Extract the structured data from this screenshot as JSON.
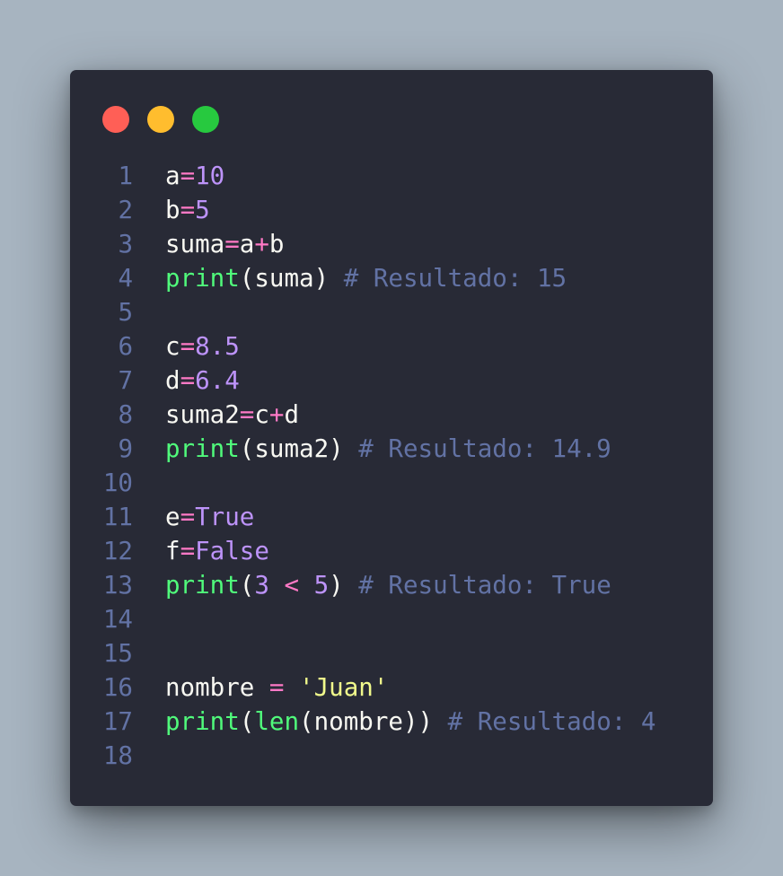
{
  "window": {
    "controls": {
      "close_color": "#ff5f56",
      "minimize_color": "#ffbd2e",
      "maximize_color": "#27c93f"
    }
  },
  "code": {
    "lines": [
      {
        "number": "1",
        "tokens": [
          {
            "t": "id",
            "v": "a"
          },
          {
            "t": "op",
            "v": "="
          },
          {
            "t": "num",
            "v": "10"
          }
        ]
      },
      {
        "number": "2",
        "tokens": [
          {
            "t": "id",
            "v": "b"
          },
          {
            "t": "op",
            "v": "="
          },
          {
            "t": "num",
            "v": "5"
          }
        ]
      },
      {
        "number": "3",
        "tokens": [
          {
            "t": "id",
            "v": "suma"
          },
          {
            "t": "op",
            "v": "="
          },
          {
            "t": "id",
            "v": "a"
          },
          {
            "t": "op",
            "v": "+"
          },
          {
            "t": "id",
            "v": "b"
          }
        ]
      },
      {
        "number": "4",
        "tokens": [
          {
            "t": "fn",
            "v": "print"
          },
          {
            "t": "punc",
            "v": "("
          },
          {
            "t": "id",
            "v": "suma"
          },
          {
            "t": "punc",
            "v": ")"
          },
          {
            "t": "space",
            "v": " "
          },
          {
            "t": "comment",
            "v": "# Resultado: 15"
          }
        ]
      },
      {
        "number": "5",
        "tokens": []
      },
      {
        "number": "6",
        "tokens": [
          {
            "t": "id",
            "v": "c"
          },
          {
            "t": "op",
            "v": "="
          },
          {
            "t": "num",
            "v": "8.5"
          }
        ]
      },
      {
        "number": "7",
        "tokens": [
          {
            "t": "id",
            "v": "d"
          },
          {
            "t": "op",
            "v": "="
          },
          {
            "t": "num",
            "v": "6.4"
          }
        ]
      },
      {
        "number": "8",
        "tokens": [
          {
            "t": "id",
            "v": "suma2"
          },
          {
            "t": "op",
            "v": "="
          },
          {
            "t": "id",
            "v": "c"
          },
          {
            "t": "op",
            "v": "+"
          },
          {
            "t": "id",
            "v": "d"
          }
        ]
      },
      {
        "number": "9",
        "tokens": [
          {
            "t": "fn",
            "v": "print"
          },
          {
            "t": "punc",
            "v": "("
          },
          {
            "t": "id",
            "v": "suma2"
          },
          {
            "t": "punc",
            "v": ")"
          },
          {
            "t": "space",
            "v": " "
          },
          {
            "t": "comment",
            "v": "# Resultado: 14.9"
          }
        ]
      },
      {
        "number": "10",
        "tokens": []
      },
      {
        "number": "11",
        "tokens": [
          {
            "t": "id",
            "v": "e"
          },
          {
            "t": "op",
            "v": "="
          },
          {
            "t": "const",
            "v": "True"
          }
        ]
      },
      {
        "number": "12",
        "tokens": [
          {
            "t": "id",
            "v": "f"
          },
          {
            "t": "op",
            "v": "="
          },
          {
            "t": "const",
            "v": "False"
          }
        ]
      },
      {
        "number": "13",
        "tokens": [
          {
            "t": "fn",
            "v": "print"
          },
          {
            "t": "punc",
            "v": "("
          },
          {
            "t": "num",
            "v": "3"
          },
          {
            "t": "space",
            "v": " "
          },
          {
            "t": "op",
            "v": "<"
          },
          {
            "t": "space",
            "v": " "
          },
          {
            "t": "num",
            "v": "5"
          },
          {
            "t": "punc",
            "v": ")"
          },
          {
            "t": "space",
            "v": " "
          },
          {
            "t": "comment",
            "v": "# Resultado: True"
          }
        ]
      },
      {
        "number": "14",
        "tokens": []
      },
      {
        "number": "15",
        "tokens": []
      },
      {
        "number": "16",
        "tokens": [
          {
            "t": "id",
            "v": "nombre"
          },
          {
            "t": "space",
            "v": " "
          },
          {
            "t": "op",
            "v": "="
          },
          {
            "t": "space",
            "v": " "
          },
          {
            "t": "str",
            "v": "'Juan'"
          }
        ]
      },
      {
        "number": "17",
        "tokens": [
          {
            "t": "fn",
            "v": "print"
          },
          {
            "t": "punc",
            "v": "("
          },
          {
            "t": "fn",
            "v": "len"
          },
          {
            "t": "punc",
            "v": "("
          },
          {
            "t": "id",
            "v": "nombre"
          },
          {
            "t": "punc",
            "v": "))"
          },
          {
            "t": "space",
            "v": " "
          },
          {
            "t": "comment",
            "v": "# Resultado: 4"
          }
        ]
      },
      {
        "number": "18",
        "tokens": []
      }
    ]
  }
}
